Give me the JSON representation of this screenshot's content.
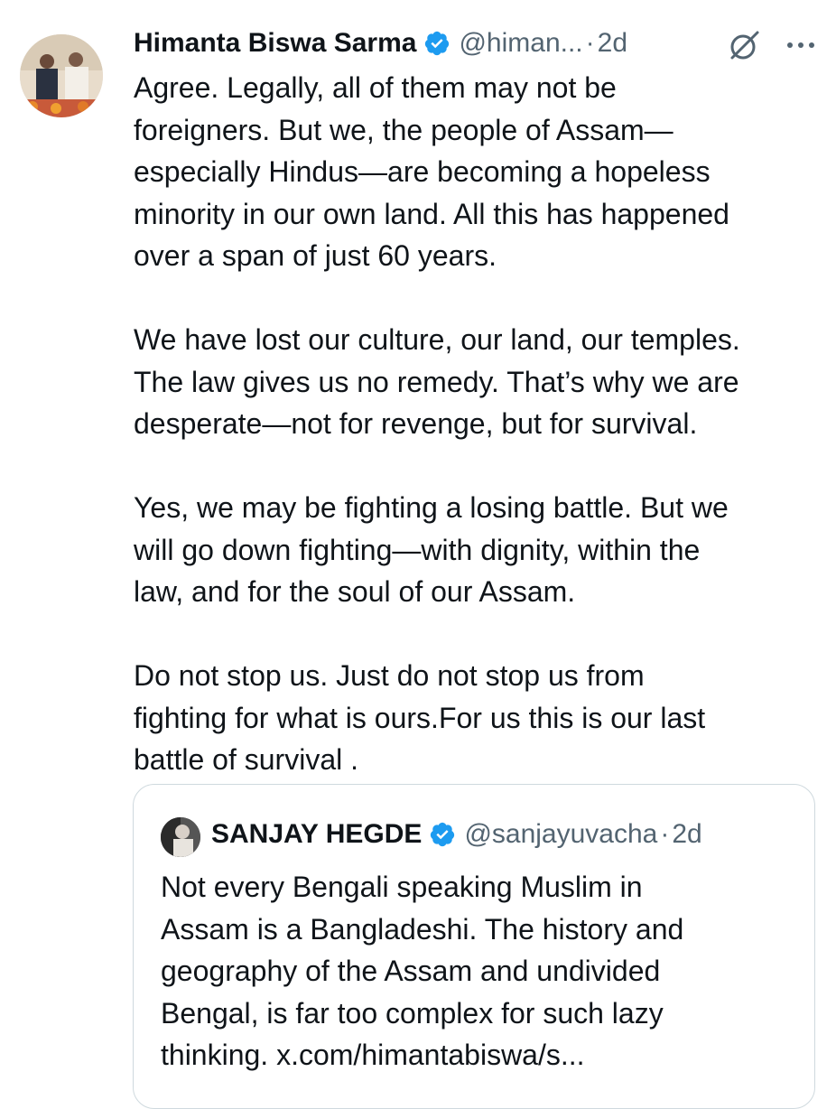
{
  "tweet": {
    "author_name": "Himanta Biswa Sarma",
    "handle": "@himan...",
    "separator": "·",
    "time": "2d",
    "verified_icon": "verified-badge-icon",
    "grok_icon": "grok-icon",
    "more_icon": "more-icon",
    "lines": [
      "Agree. Legally, all of them may not be",
      "foreigners. But we, the people of Assam—",
      "especially Hindus—are becoming a hopeless",
      "minority in our own land. All this has happened",
      "over a span of just 60 years.",
      "",
      "We have lost our culture, our land, our temples.",
      "The law gives us no remedy. That’s why we are",
      "desperate—not for revenge, but for survival.",
      "",
      "Yes, we may be fighting a losing battle. But we",
      "will go down fighting—with dignity, within the",
      "law, and for the soul of our Assam.",
      "",
      "Do not stop us. Just do not stop us from",
      "fighting for what is ours.For us this is our last",
      "battle of survival ."
    ]
  },
  "quoted_tweet": {
    "author_name": "SANJAY HEGDE",
    "handle": "@sanjayuvacha",
    "separator": "·",
    "time": "2d",
    "lines": [
      "Not every Bengali speaking Muslim in",
      "Assam is a Bangladeshi. The history and",
      "geography of the Assam and undivided",
      "Bengal, is far too complex for such lazy",
      "thinking. x.com/himantabiswa/s..."
    ]
  },
  "colors": {
    "verified_blue": "#1d9bf0",
    "secondary_text": "#536471",
    "primary_text": "#0f1419",
    "border": "#cfd9de"
  }
}
